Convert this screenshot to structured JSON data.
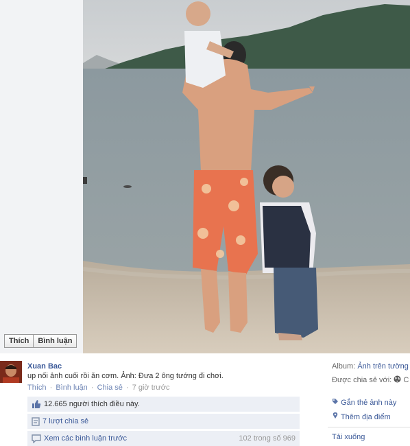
{
  "actions": {
    "like_label": "Thích",
    "comment_label": "Bình luận"
  },
  "post": {
    "author": "Xuan Bac",
    "caption": "up nối ảnh cuối rồi ăn cơm. Ảnh: Đưa 2 ông tướng đi chơi.",
    "like_link": "Thích",
    "comment_link": "Bình luận",
    "share_link": "Chia sẻ",
    "separator": "·",
    "time": "7 giờ trước"
  },
  "ufi": {
    "likes_text": "12.665 người thích điều này.",
    "shares_text": "7 lượt chia sẻ",
    "view_previous": "Xem các bình luận trước",
    "comment_count": "102 trong số 969"
  },
  "sidebar": {
    "album_label": "Album:",
    "album_value": "Ảnh trên tường",
    "shared_with_label": "Được chia sẻ với:",
    "shared_with_trailing": "C",
    "tag_photo": "Gắn thẻ ảnh này",
    "add_location": "Thêm địa điểm",
    "download": "Tải xuống"
  },
  "colors": {
    "link": "#3b5998",
    "ufi_bg": "#eceff5"
  }
}
